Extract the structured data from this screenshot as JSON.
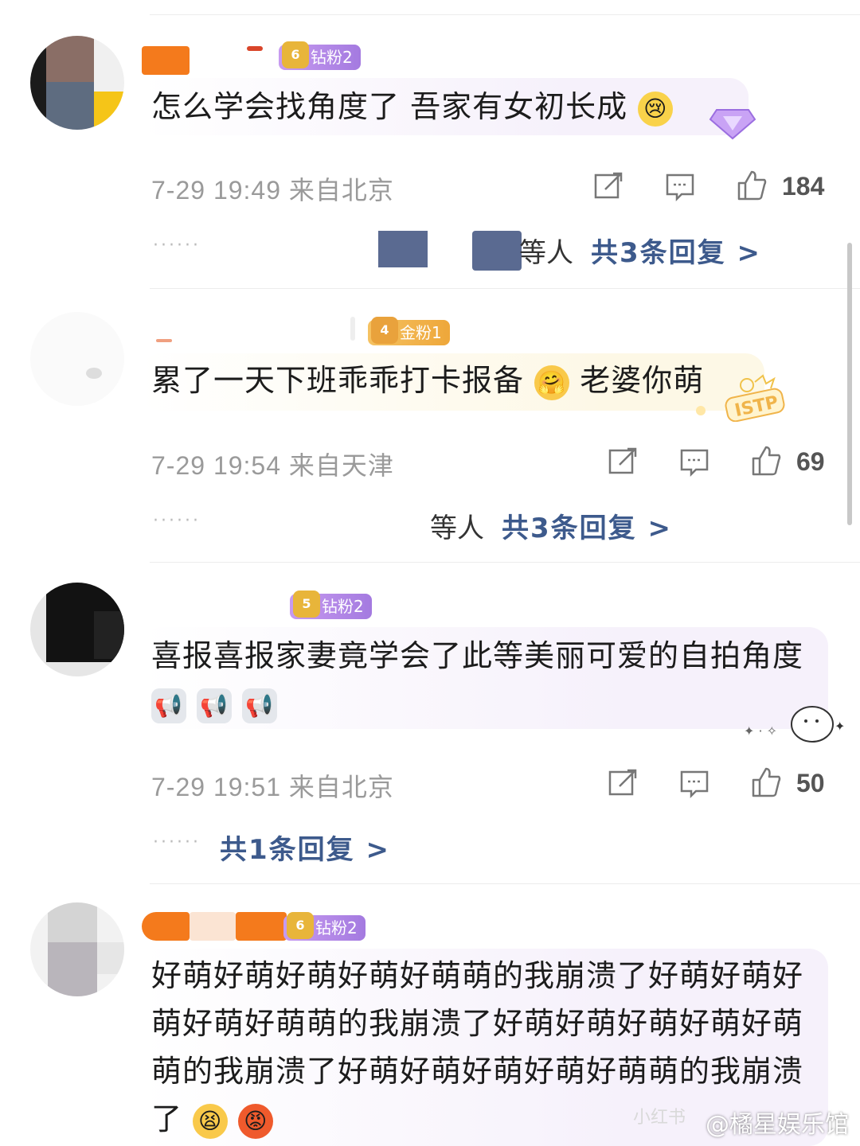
{
  "comments": [
    {
      "badge": "钻粉2",
      "badge_level": "6",
      "text": "怎么学会找角度了 吾家有女初长成",
      "emoji": "crying-face",
      "meta": "7-29 19:49 来自北京",
      "likes": "184",
      "reply_prefix": "等人",
      "replies": "共3条回复 >"
    },
    {
      "badge": "金粉1",
      "badge_level": "4",
      "text": "累了一天下班乖乖打卡报备",
      "emoji": "hugging-face",
      "text_suffix": "老婆你萌",
      "sticker": "ISTP",
      "meta": "7-29 19:54 来自天津",
      "likes": "69",
      "reply_prefix": "等人",
      "replies": "共3条回复 >"
    },
    {
      "badge": "钻粉2",
      "badge_level": "5",
      "text": "喜报喜报家妻竟学会了此等美丽可爱的自拍角度",
      "emoji": "megaphone",
      "meta": "7-29 19:51 来自北京",
      "likes": "50",
      "replies": "共1条回复 >"
    },
    {
      "badge": "钻粉2",
      "badge_level": "6",
      "text": "好萌好萌好萌好萌好萌萌的我崩溃了好萌好萌好萌好萌好萌萌的我崩溃了好萌好萌好萌好萌好萌萌的我崩溃了好萌好萌好萌好萌好萌萌的我崩溃了",
      "emoji_end": [
        "tired-face",
        "angry-face"
      ]
    }
  ],
  "dots": "······",
  "watermark": "@橘星娱乐馆",
  "faint_mark": "小红书",
  "colors": {
    "reply_blue": "#3d5a8c",
    "meta_gray": "#9a9a9a",
    "diamond_badge": "#b88be6",
    "gold_badge": "#f0b44a",
    "bubble_purple": "#f6f1fb",
    "bubble_yellow": "#fdf8e6"
  }
}
